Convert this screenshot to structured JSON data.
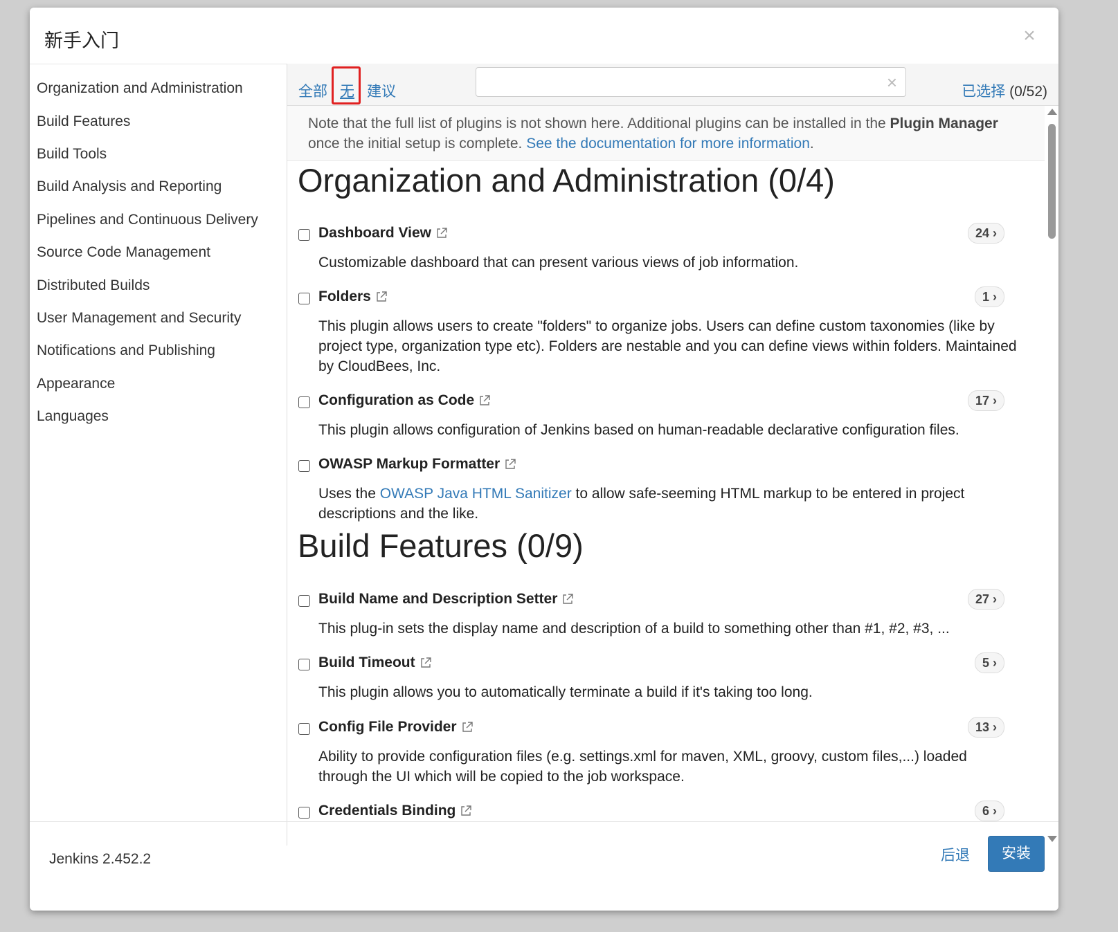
{
  "dialog": {
    "title": "新手入门"
  },
  "sidebar": {
    "items": [
      {
        "label": "Organization and Administration"
      },
      {
        "label": "Build Features"
      },
      {
        "label": "Build Tools"
      },
      {
        "label": "Build Analysis and Reporting"
      },
      {
        "label": "Pipelines and Continuous Delivery"
      },
      {
        "label": "Source Code Management"
      },
      {
        "label": "Distributed Builds"
      },
      {
        "label": "User Management and Security"
      },
      {
        "label": "Notifications and Publishing"
      },
      {
        "label": "Appearance"
      },
      {
        "label": "Languages"
      }
    ]
  },
  "toolbar": {
    "filter_all": "全部",
    "filter_none": "无",
    "filter_suggested": "建议",
    "search_value": "",
    "search_placeholder": "",
    "selected_label": "已选择",
    "selected_count": "(0/52)"
  },
  "note": {
    "text_1": "Note that the full list of plugins is not shown here. Additional plugins can be installed in the ",
    "bold": "Plugin Manager",
    "text_2": " once the initial setup is complete. ",
    "link": "See the documentation for more information",
    "text_3": "."
  },
  "sections": [
    {
      "title": "Organization and Administration (0/4)",
      "plugins": [
        {
          "name": "Dashboard View",
          "deps": "24",
          "desc": "Customizable dashboard that can present various views of job information."
        },
        {
          "name": "Folders",
          "deps": "1",
          "desc": "This plugin allows users to create \"folders\" to organize jobs. Users can define custom taxonomies (like by project type, organization type etc). Folders are nestable and you can define views within folders. Maintained by CloudBees, Inc."
        },
        {
          "name": "Configuration as Code",
          "deps": "17",
          "desc": "This plugin allows configuration of Jenkins based on human-readable declarative configuration files."
        },
        {
          "name": "OWASP Markup Formatter",
          "deps": "",
          "desc_1": "Uses the ",
          "desc_link": "OWASP Java HTML Sanitizer",
          "desc_2": " to allow safe-seeming HTML markup to be entered in project descriptions and the like."
        }
      ]
    },
    {
      "title": "Build Features (0/9)",
      "plugins": [
        {
          "name": "Build Name and Description Setter",
          "deps": "27",
          "desc": "This plug-in sets the display name and description of a build to something other than #1, #2, #3, ..."
        },
        {
          "name": "Build Timeout",
          "deps": "5",
          "desc": "This plugin allows you to automatically terminate a build if it's taking too long."
        },
        {
          "name": "Config File Provider",
          "deps": "13",
          "desc": "Ability to provide configuration files (e.g. settings.xml for maven, XML, groovy, custom files,...) loaded through the UI which will be copied to the job workspace."
        },
        {
          "name": "Credentials Binding",
          "deps": "6",
          "desc": ""
        }
      ]
    }
  ],
  "footer": {
    "version": "Jenkins 2.452.2",
    "back_label": "后退",
    "install_label": "安装"
  },
  "colors": {
    "link": "#337ab7",
    "primary_button": "#337ab7",
    "highlight_box": "#e02020"
  }
}
